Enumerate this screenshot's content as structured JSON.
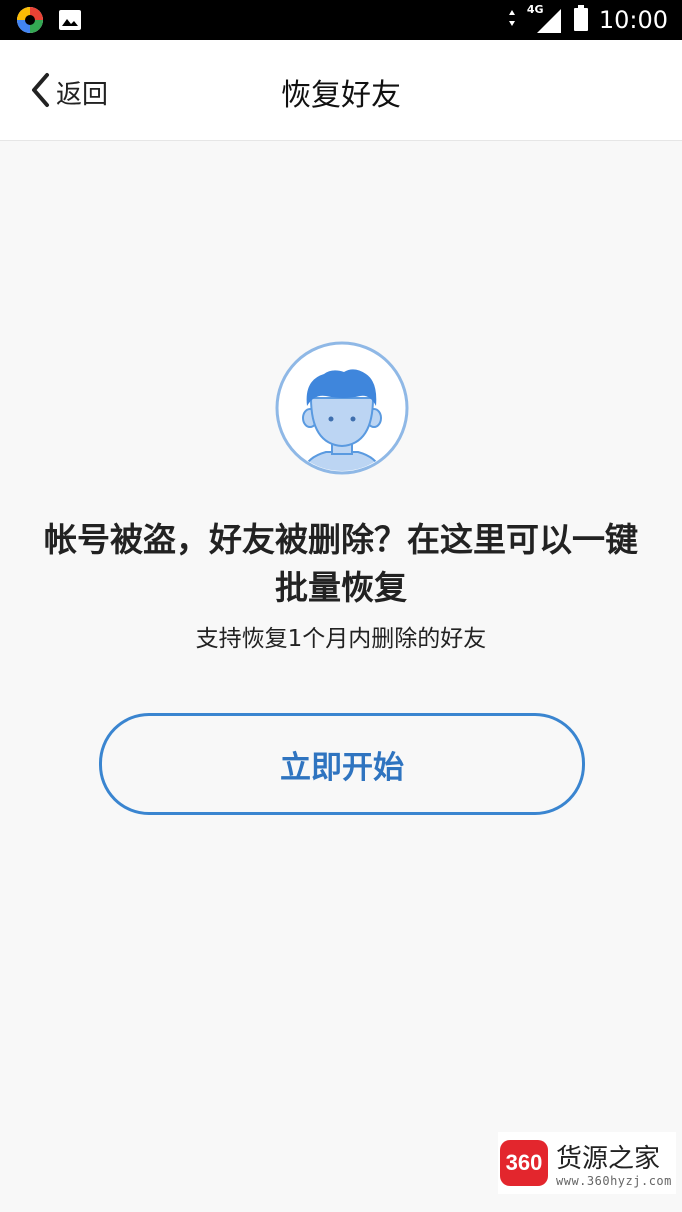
{
  "status_bar": {
    "network": "4G",
    "time": "10:00",
    "icons": [
      "app-icon",
      "image-notification-icon",
      "data-arrows-icon",
      "signal-icon",
      "battery-icon"
    ]
  },
  "nav": {
    "back_label": "返回",
    "title": "恢复好友"
  },
  "main": {
    "headline": "帐号被盗，好友被删除？在这里可以一键批量恢复",
    "subline": "支持恢复1个月内删除的好友",
    "start_button": "立即开始"
  },
  "watermark": {
    "logo_text": "360",
    "name": "货源之家",
    "url": "www.360hyzj.com"
  },
  "colors": {
    "accent": "#3a85d0",
    "button_text": "#2f74c0",
    "avatar_blue": "#4a90e2",
    "background": "#f8f8f8"
  }
}
